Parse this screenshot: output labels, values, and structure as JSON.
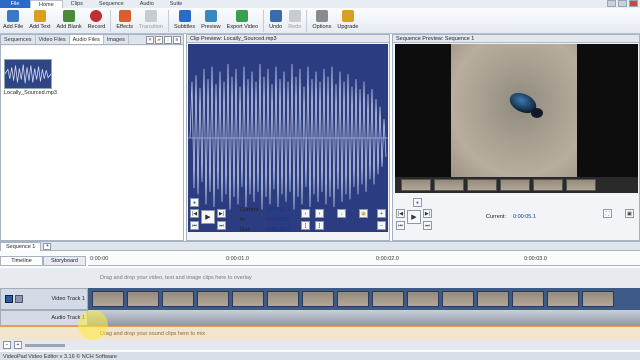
{
  "menu": {
    "file": "File",
    "items": [
      "Home",
      "Clips",
      "Sequence",
      "Audio",
      "Suite"
    ],
    "active": "Home"
  },
  "toolbar": {
    "buttons": [
      {
        "label": "Add File",
        "icon": "add-file-icon",
        "color": "#3a78c9"
      },
      {
        "label": "Add Text",
        "icon": "add-text-icon",
        "color": "#d8a020"
      },
      {
        "label": "Add Blank",
        "icon": "add-blank-icon",
        "color": "#4a8a3a"
      },
      {
        "label": "Record",
        "icon": "record-icon",
        "color": "#c03030"
      },
      {
        "label": "Effects",
        "icon": "effects-icon",
        "color": "#d86030"
      },
      {
        "label": "Transition",
        "icon": "transition-icon",
        "color": "#b0b0b0",
        "disabled": true
      },
      {
        "label": "Subtitles",
        "icon": "subtitles-icon",
        "color": "#2a6ac8"
      },
      {
        "label": "Preview",
        "icon": "preview-icon",
        "color": "#3a88c0"
      },
      {
        "label": "Export Video",
        "icon": "export-video-icon",
        "color": "#3aa050"
      },
      {
        "label": "Undo",
        "icon": "undo-icon",
        "color": "#3a6ab0"
      },
      {
        "label": "Redo",
        "icon": "redo-icon",
        "color": "#a0a8b4",
        "disabled": true
      },
      {
        "label": "Options",
        "icon": "options-icon",
        "color": "#8a8a8a"
      },
      {
        "label": "Upgrade",
        "icon": "upgrade-icon",
        "color": "#d8a020"
      }
    ]
  },
  "media": {
    "tabs": [
      "Sequences",
      "Video Files",
      "Audio Files",
      "Images"
    ],
    "active": "Audio Files",
    "file_label": "Locally_Sourced.mp3"
  },
  "clip_preview": {
    "title": "Clip Preview: Locally_Sourced.mp3",
    "current_label": "Current:",
    "current": "0:00:01.1",
    "in_label": "In:",
    "in": "0:00:00.0",
    "out_label": "Out:",
    "out": "0:01:28.9"
  },
  "sequence_preview": {
    "title": "Sequence Preview: Sequence 1",
    "current_label": "Current:",
    "current": "0:00:05.1"
  },
  "timeline": {
    "sequence_tab": "Sequence 1",
    "mode_timeline": "Timeline",
    "mode_storyboard": "Storyboard",
    "ticks": [
      "0:00:00",
      "0:00:01.0",
      "0:00:02.0",
      "0:00:03.0"
    ],
    "overlay_hint": "Drag and drop your video, text and image clips here to overlay",
    "video_track": "Video Track 1",
    "audio_track": "Audio Track 1",
    "audio_hint": "Drag and drop your sound clips here to mix"
  },
  "status": {
    "text": "VideoPad Video Editor v 3.16 © NCH Software"
  }
}
